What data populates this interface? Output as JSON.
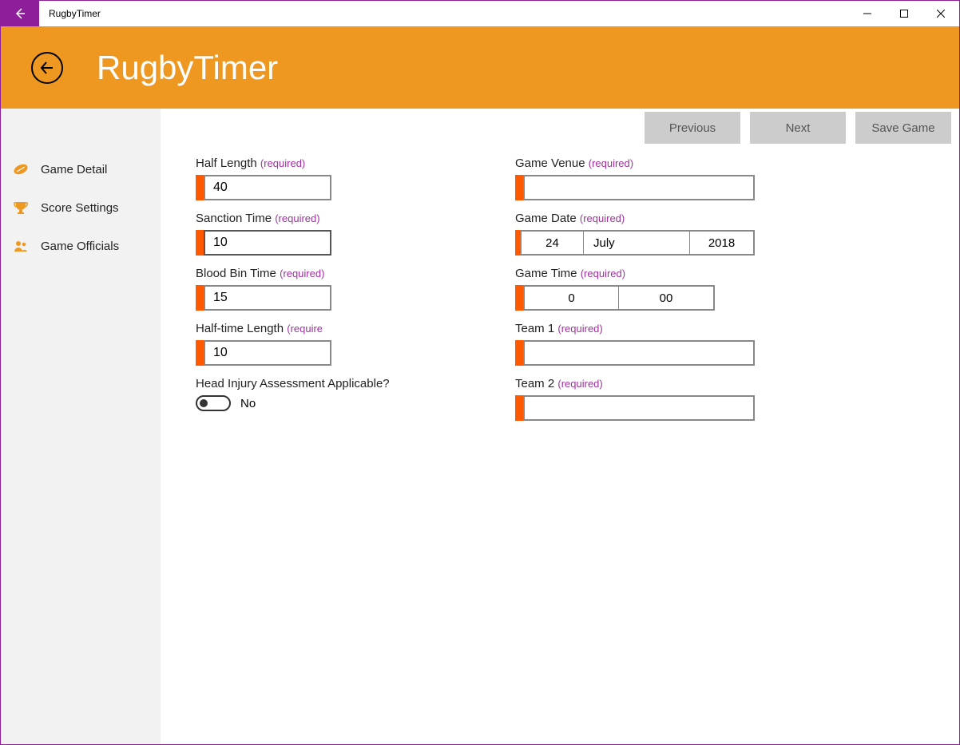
{
  "window": {
    "title": "RugbyTimer"
  },
  "header": {
    "app_title": "RugbyTimer"
  },
  "sidebar": {
    "items": [
      {
        "label": "Game Detail",
        "icon": "football-icon"
      },
      {
        "label": "Score Settings",
        "icon": "trophy-icon"
      },
      {
        "label": "Game Officials",
        "icon": "people-icon"
      }
    ]
  },
  "actions": {
    "previous": "Previous",
    "next": "Next",
    "save": "Save Game"
  },
  "required_text": "(required)",
  "form": {
    "half_length": {
      "label": "Half Length",
      "value": "40"
    },
    "sanction_time": {
      "label": "Sanction Time",
      "value": "10"
    },
    "blood_bin_time": {
      "label": "Blood Bin Time",
      "value": "15"
    },
    "half_time_length": {
      "label": "Half-time Length",
      "value": "10"
    },
    "hia": {
      "label": "Head Injury Assessment Applicable?",
      "state_label": "No",
      "value": false
    },
    "game_venue": {
      "label": "Game Venue",
      "value": ""
    },
    "game_date": {
      "label": "Game Date",
      "day": "24",
      "month": "July",
      "year": "2018"
    },
    "game_time": {
      "label": "Game Time",
      "hour": "0",
      "minute": "00"
    },
    "team1": {
      "label": "Team 1",
      "value": ""
    },
    "team2": {
      "label": "Team 2",
      "value": ""
    }
  }
}
